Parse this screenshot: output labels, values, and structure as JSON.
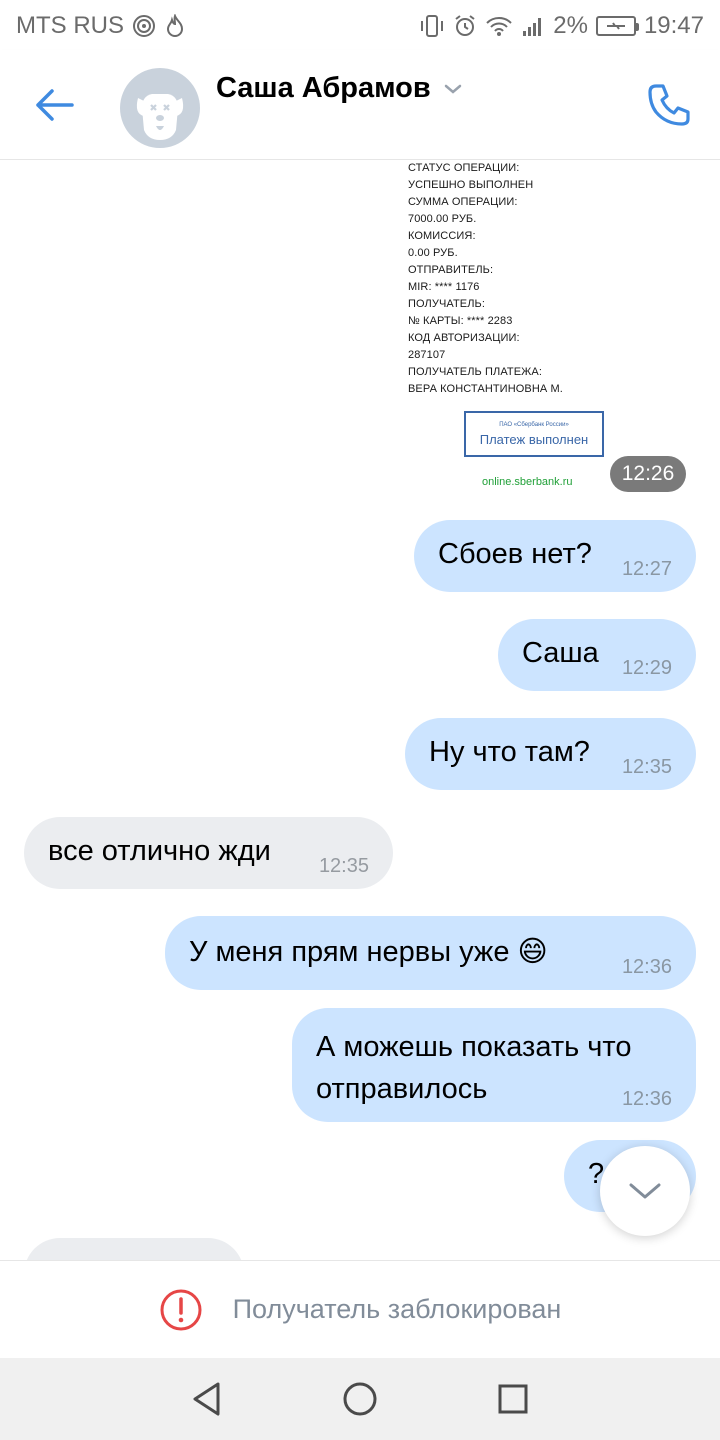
{
  "status_bar": {
    "carrier": "MTS RUS",
    "battery": "2%",
    "time": "19:47"
  },
  "header": {
    "contact_name": "Саша Абрамов"
  },
  "receipt": {
    "lines": [
      "СТАТУС ОПЕРАЦИИ:",
      "УСПЕШНО ВЫПОЛНЕН",
      "СУММА ОПЕРАЦИИ:",
      "7000.00 РУБ.",
      "КОМИССИЯ:",
      "0.00 РУБ.",
      "ОТПРАВИТЕЛЬ:",
      "MIR: **** 1176",
      "ПОЛУЧАТЕЛЬ:",
      "№ КАРТЫ: **** 2283",
      "КОД АВТОРИЗАЦИИ:",
      "287107",
      "ПОЛУЧАТЕЛЬ ПЛАТЕЖА:",
      "ВЕРА КОНСТАНТИНОВНА М."
    ],
    "stamp_small": "ПАО «Сбербанк России»",
    "stamp_label": "Платеж выполнен",
    "site": "online.sberbank.ru",
    "time": "12:26"
  },
  "messages": [
    {
      "dir": "out",
      "text": "Сбоев нет?",
      "time": "12:27"
    },
    {
      "dir": "out",
      "text": "Саша",
      "time": "12:29"
    },
    {
      "dir": "out",
      "text": "Ну что там?",
      "time": "12:35"
    },
    {
      "dir": "in",
      "text": "все отлично жди",
      "time": "12:35"
    },
    {
      "dir": "out",
      "text": "У меня прям нервы уже",
      "emoji": "😄",
      "time": "12:36"
    },
    {
      "dir": "out",
      "text": "А можешь показать что отправилось",
      "line1": "А можешь показать что",
      "line2": "отправилось",
      "time": "12:36"
    },
    {
      "dir": "out",
      "text": "?"
    }
  ],
  "blocked_bar": {
    "icon": "alert-circle-icon",
    "text": "Получатель заблокирован"
  },
  "colors": {
    "accent": "#3f8ae0",
    "outgoing_bubble": "#cce4ff",
    "incoming_bubble": "#ebedf0",
    "alert": "#e64646"
  }
}
